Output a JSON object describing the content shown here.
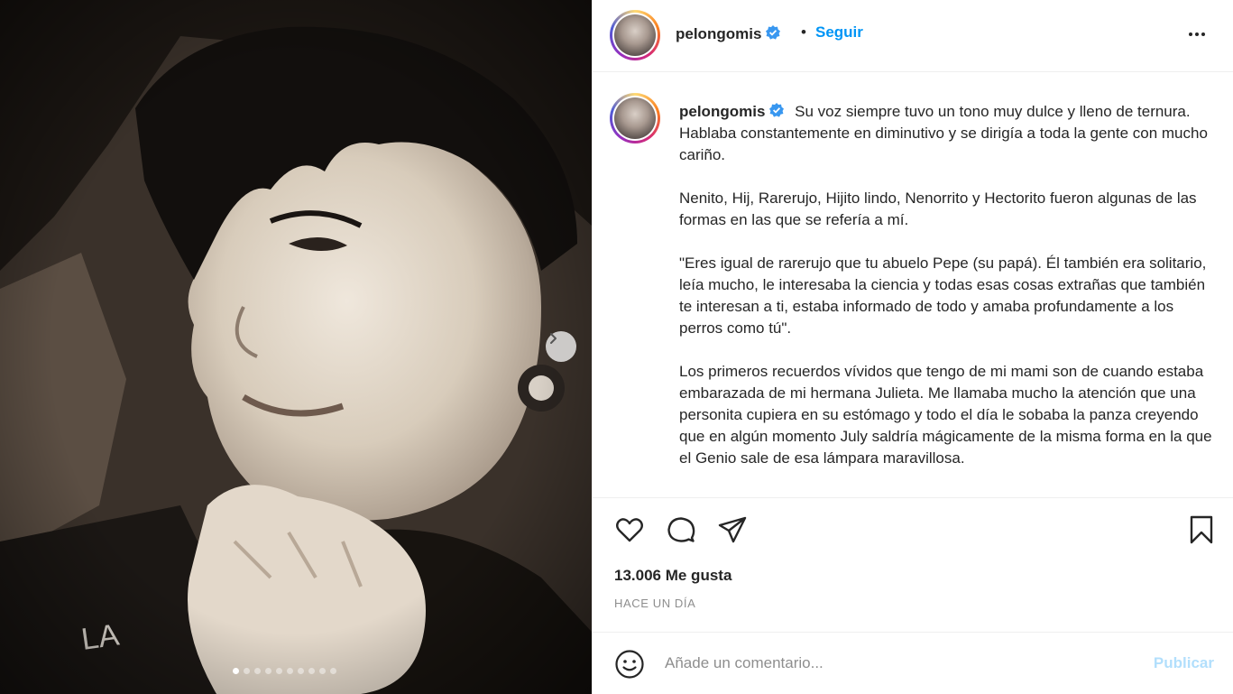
{
  "post": {
    "username": "pelongomis",
    "separator": "•",
    "follow_label": "Seguir",
    "caption_paragraphs": [
      "Su voz siempre tuvo un tono muy dulce y lleno de ternura. Hablaba constantemente en diminutivo y se dirigía a toda la gente con mucho cariño.",
      "Nenito, Hij, Rarerujo, Hijito lindo, Nenorrito y Hectorito fueron algunas de las formas en las que se refería a mí.",
      "\"Eres igual de rarerujo que tu abuelo Pepe (su papá). Él también era solitario, leía mucho, le interesaba la ciencia y todas esas cosas extrañas que también te interesan a ti, estaba informado de todo y amaba profundamente a los perros como tú\".",
      "Los primeros recuerdos vívidos que tengo de mi mami son de cuando estaba embarazada de mi hermana Julieta. Me llamaba mucho la atención que una personita cupiera en su estómago y todo el día le sobaba la panza creyendo que en algún momento July saldría mágicamente de la misma forma en la que el Genio sale de esa lámpara maravillosa."
    ],
    "likes_text": "13.006 Me gusta",
    "timestamp": "HACE UN DÍA",
    "comment_placeholder": "Añade un comentario...",
    "publish_label": "Publicar",
    "carousel": {
      "total": 10,
      "active_index": 0
    },
    "photo_overlay_text": "LA"
  },
  "colors": {
    "link_blue": "#0095f6",
    "verified_blue": "#3897f0",
    "publish_disabled": "#b2dffc",
    "muted_text": "#8e8e8e"
  },
  "icons": [
    "verified-badge-icon",
    "more-options-icon",
    "chevron-right-icon",
    "heart-icon",
    "comment-icon",
    "share-icon",
    "bookmark-icon",
    "emoji-icon"
  ]
}
